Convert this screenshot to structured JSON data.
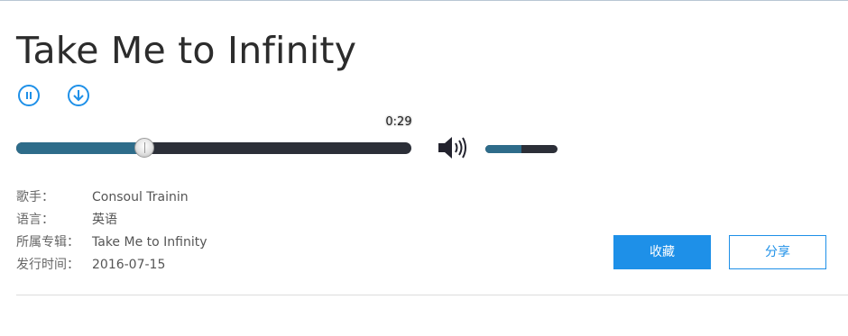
{
  "song": {
    "title": "Take Me to Infinity"
  },
  "player": {
    "current_time": "0:29",
    "progress_fraction": 0.324,
    "volume_fraction": 0.5,
    "pause_icon": "pause-icon",
    "download_icon": "download-icon",
    "volume_icon": "speaker-icon"
  },
  "info": [
    {
      "label": "歌手：",
      "value": "Consoul Trainin"
    },
    {
      "label": "语言：",
      "value": "英语"
    },
    {
      "label": "所属专辑：",
      "value": "Take Me to Infinity"
    },
    {
      "label": "发行时间：",
      "value": "2016-07-15"
    }
  ],
  "actions": {
    "collect_label": "收藏",
    "share_label": "分享"
  },
  "colors": {
    "accent": "#1e90e8",
    "progress_fill": "#2e6c8a",
    "track": "#2c2f38"
  }
}
